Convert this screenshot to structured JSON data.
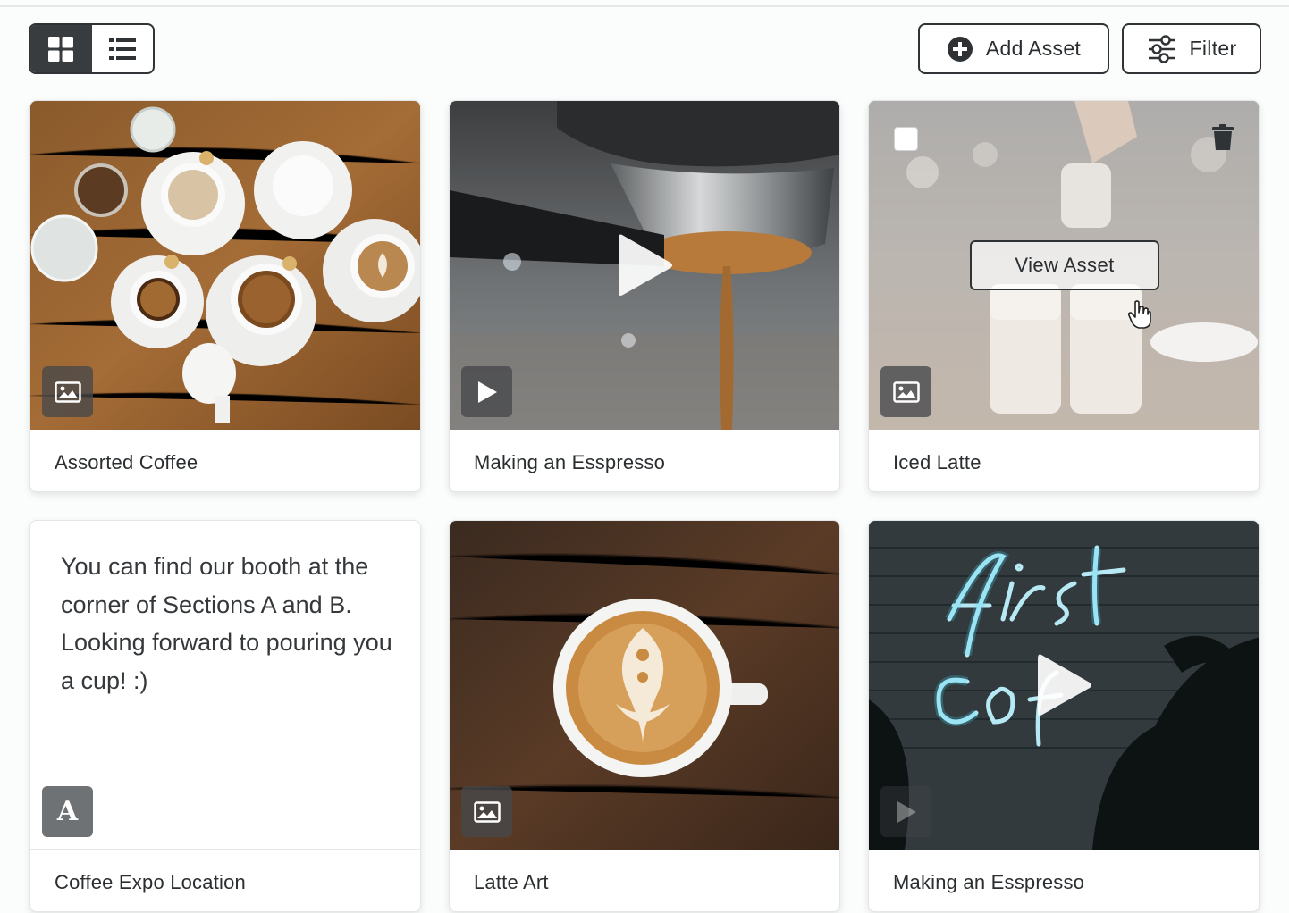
{
  "toolbar": {
    "grid_view_icon": "grid-icon",
    "list_view_icon": "list-icon",
    "add_asset_label": "Add Asset",
    "filter_label": "Filter"
  },
  "cards": [
    {
      "title": "Assorted Coffee",
      "type": "image",
      "badge_icon": "image-icon"
    },
    {
      "title": "Making an Esspresso",
      "type": "video",
      "badge_icon": "play-icon"
    },
    {
      "title": "Iced Latte",
      "type": "image",
      "badge_icon": "image-icon",
      "hover_action": "View Asset"
    },
    {
      "title": "Coffee Expo Location",
      "type": "text",
      "badge_icon": "text-icon",
      "badge_letter": "A",
      "body": "You can find our booth at the corner of Sections A and B. Looking forward to pouring you a cup! :)"
    },
    {
      "title": "Latte Art",
      "type": "image",
      "badge_icon": "image-icon"
    },
    {
      "title": "Making an Esspresso",
      "type": "video",
      "badge_icon": "play-icon",
      "neon_text": "first coffee"
    }
  ],
  "colors": {
    "border": "#2f3336",
    "active_toggle": "#383c3f",
    "badge_bg": "#46484a"
  }
}
